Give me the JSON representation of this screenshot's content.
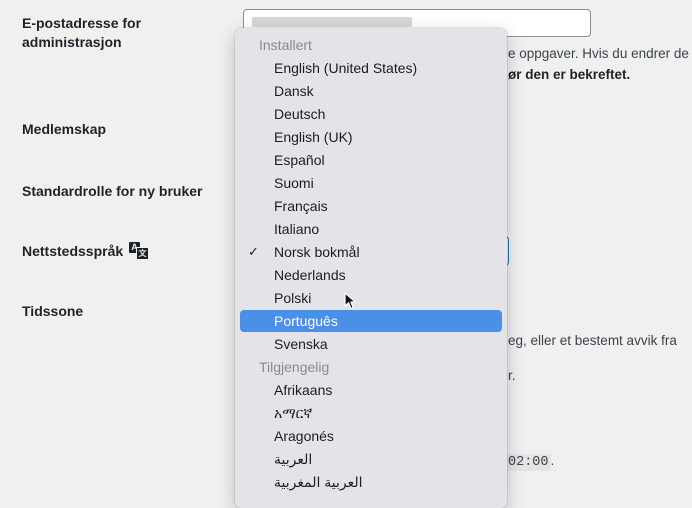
{
  "settings": {
    "email_label_line1": "E-postadresse for",
    "email_label_line2": "administrasjon",
    "email_desc_1": "e oppgaver. Hvis du endrer de",
    "email_desc_2": "ør den er bekreftet.",
    "membership_label": "Medlemskap",
    "default_role_label": "Standardrolle for ny bruker",
    "site_language_label": "Nettstedsspråk",
    "timezone_label": "Tidssone",
    "timezone_desc": "eg, eller et bestemt avvik fra",
    "timezone_desc_2": "r.",
    "time_value": "02:00",
    "time_suffix": "."
  },
  "icons": {
    "translate": "language-translate-icon",
    "translate_glyph_a": "A",
    "translate_glyph_b": "文",
    "check": "✓"
  },
  "language_dropdown": {
    "installed_group": "Installert",
    "available_group": "Tilgjengelig",
    "installed": [
      "English (United States)",
      "Dansk",
      "Deutsch",
      "English (UK)",
      "Español",
      "Suomi",
      "Français",
      "Italiano",
      "Norsk bokmål",
      "Nederlands",
      "Polski",
      "Português",
      "Svenska"
    ],
    "available": [
      "Afrikaans",
      "አማርኛ",
      "Aragonés",
      "العربية",
      "العربية المغربية"
    ],
    "checked": "Norsk bokmål",
    "highlighted": "Português"
  },
  "colors": {
    "highlight": "#4a90e6",
    "focus_border": "#2271b1"
  }
}
